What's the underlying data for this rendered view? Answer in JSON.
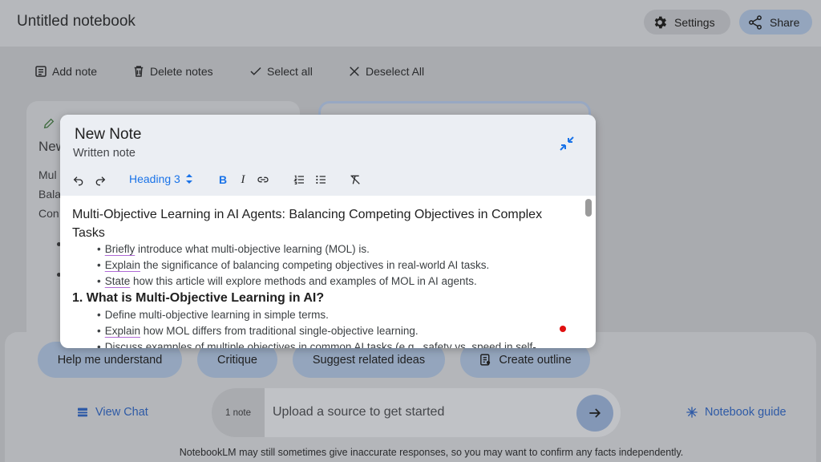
{
  "header": {
    "title": "Untitled notebook",
    "settings_label": "Settings",
    "share_label": "Share"
  },
  "toolbar": {
    "add_note": "Add note",
    "delete_notes": "Delete notes",
    "select_all": "Select all",
    "deselect_all": "Deselect All"
  },
  "background_note": {
    "title_fragment": "New",
    "lines": [
      "Mul",
      "Bala",
      "Con"
    ]
  },
  "modal": {
    "title": "New Note",
    "subtitle": "Written note",
    "heading_select": "Heading 3",
    "content": {
      "heading": "Multi-Objective Learning in AI Agents: Balancing Competing Objectives in Complex Tasks",
      "intro_items": [
        {
          "verb": "Briefly",
          "rest": " introduce what multi-objective learning (MOL) is."
        },
        {
          "verb": "Explain",
          "rest": " the significance of balancing competing objectives in real-world AI tasks."
        },
        {
          "verb": "State",
          "rest": " how this article will explore methods and examples of MOL in AI agents."
        }
      ],
      "section1_title": "1. What is Multi-Objective Learning in AI?",
      "section1_items": [
        {
          "verb": "",
          "rest": "Define multi-objective learning in simple terms."
        },
        {
          "verb": "Explain",
          "rest": " how MOL differs from traditional single-objective learning."
        },
        {
          "verb": "",
          "rest": "Discuss examples of multiple objectives in common AI tasks (e.g., safety vs. speed in self-"
        }
      ]
    }
  },
  "chips": {
    "help": "Help me understand",
    "critique": "Critique",
    "suggest": "Suggest related ideas",
    "outline": "Create outline"
  },
  "chat": {
    "view_chat": "View Chat",
    "note_count": "1 note",
    "placeholder": "Upload a source to get started",
    "notebook_guide": "Notebook guide"
  },
  "footer": {
    "disclaimer": "NotebookLM may still sometimes give inaccurate responses, so you may want to confirm any facts independently."
  },
  "icons": {
    "settings": "gear-icon",
    "share": "share-icon",
    "add_note": "note-add-icon",
    "delete": "trash-icon",
    "select_all": "check-icon",
    "deselect_all": "close-icon",
    "collapse": "collapse-icon",
    "send": "arrow-right-icon",
    "view_chat": "chat-icon",
    "notebook_guide": "sparkle-icon"
  },
  "colors": {
    "accent": "#1a73e8",
    "chip_bg": "#94a5bd",
    "spell_underline": "#b06ad6"
  }
}
